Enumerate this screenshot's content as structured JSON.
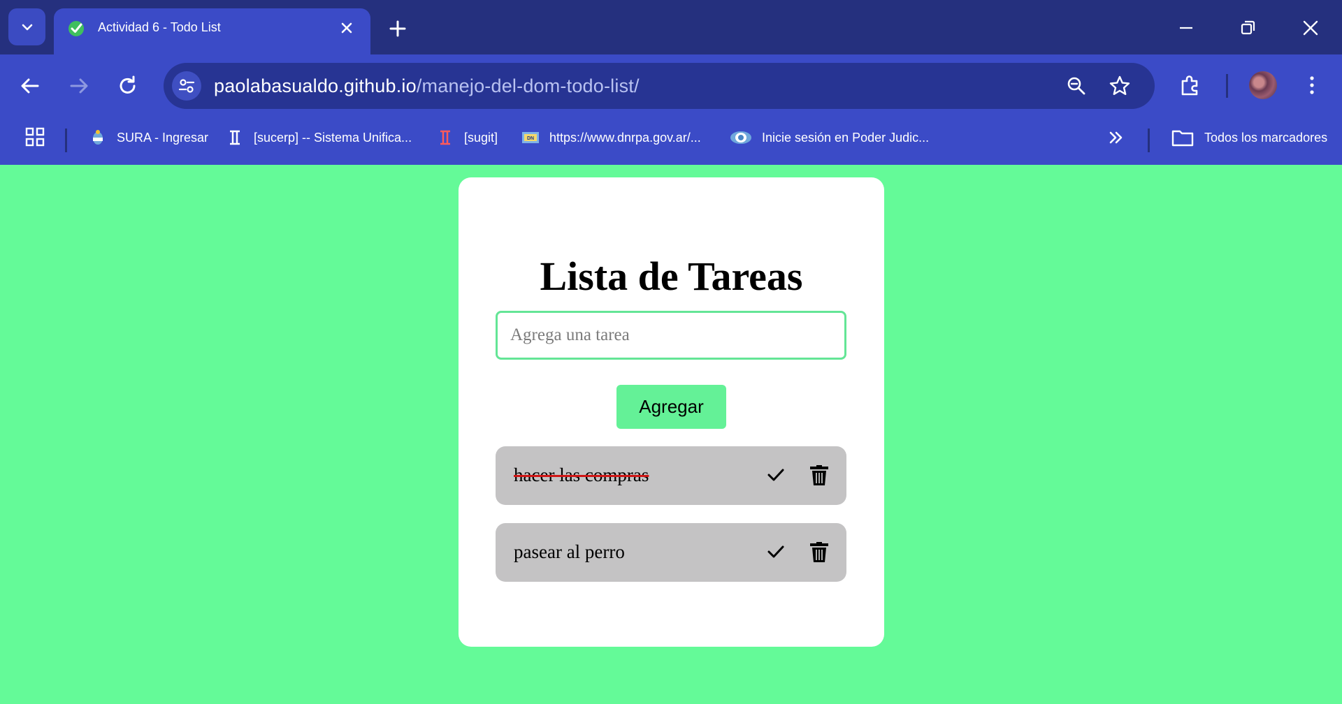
{
  "browser": {
    "tab": {
      "title": "Actividad 6 - Todo List"
    },
    "url": {
      "domain": "paolabasualdo.github.io",
      "path": "/manejo-del-dom-todo-list/"
    },
    "bookmarks": [
      {
        "label": "SURA - Ingresar"
      },
      {
        "label": "[sucerp] -- Sistema Unifica..."
      },
      {
        "label": "[sugit]"
      },
      {
        "label": "https://www.dnrpa.gov.ar/..."
      },
      {
        "label": "Inicie sesión en Poder Judic..."
      }
    ],
    "all_bookmarks_label": "Todos los marcadores"
  },
  "page": {
    "title": "Lista de Tareas",
    "input_placeholder": "Agrega una tarea",
    "add_button_label": "Agregar",
    "tasks": [
      {
        "text": "hacer las compras",
        "completed": true
      },
      {
        "text": "pasear al perro",
        "completed": false
      }
    ]
  },
  "colors": {
    "page_background": "#64fa98",
    "accent_green": "#64f197",
    "task_background": "#c4c3c4",
    "strike_red": "#d01616",
    "chrome_blue": "#3b4bc7",
    "chrome_dark": "#25307e"
  }
}
